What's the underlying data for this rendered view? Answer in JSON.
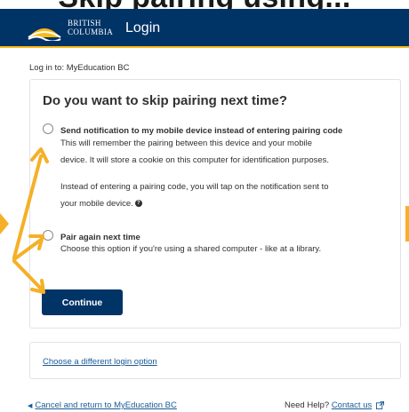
{
  "top_banner": {
    "title": "Skip pairing using..."
  },
  "header": {
    "brand_line1": "BRITISH",
    "brand_line2": "COLUMBIA",
    "title": "Login"
  },
  "breadcrumb": "Log in to: MyEducation BC",
  "card": {
    "question": "Do you want to skip pairing next time?",
    "option1": {
      "label": "Send notification to my mobile device instead of entering pairing code",
      "line1": "This will remember the pairing between this device and your mobile",
      "line2": "device. It will store a cookie on this computer for identification purposes.",
      "line3": "Instead of entering a pairing code, you will tap on the notification sent to",
      "line4": "your mobile device."
    },
    "option2": {
      "label": "Pair again next time",
      "line1": "Choose this option if you're using a shared computer - like at a library."
    },
    "continue_label": "Continue"
  },
  "alt_login_link": "Choose a different login option",
  "footer": {
    "cancel_link": "Cancel and return to MyEducation BC",
    "help_text": "Need Help?",
    "contact_link": "Contact us"
  },
  "colors": {
    "header_bg": "#003366",
    "accent": "#fcba19",
    "link": "#1a5a96",
    "button": "#003366",
    "annotation_arrow": "#f5b027"
  },
  "icons": {
    "logo": "bc-sun-logo",
    "help": "help-circle-icon",
    "external": "external-link-icon",
    "chevron": "chevron-left-icon"
  }
}
